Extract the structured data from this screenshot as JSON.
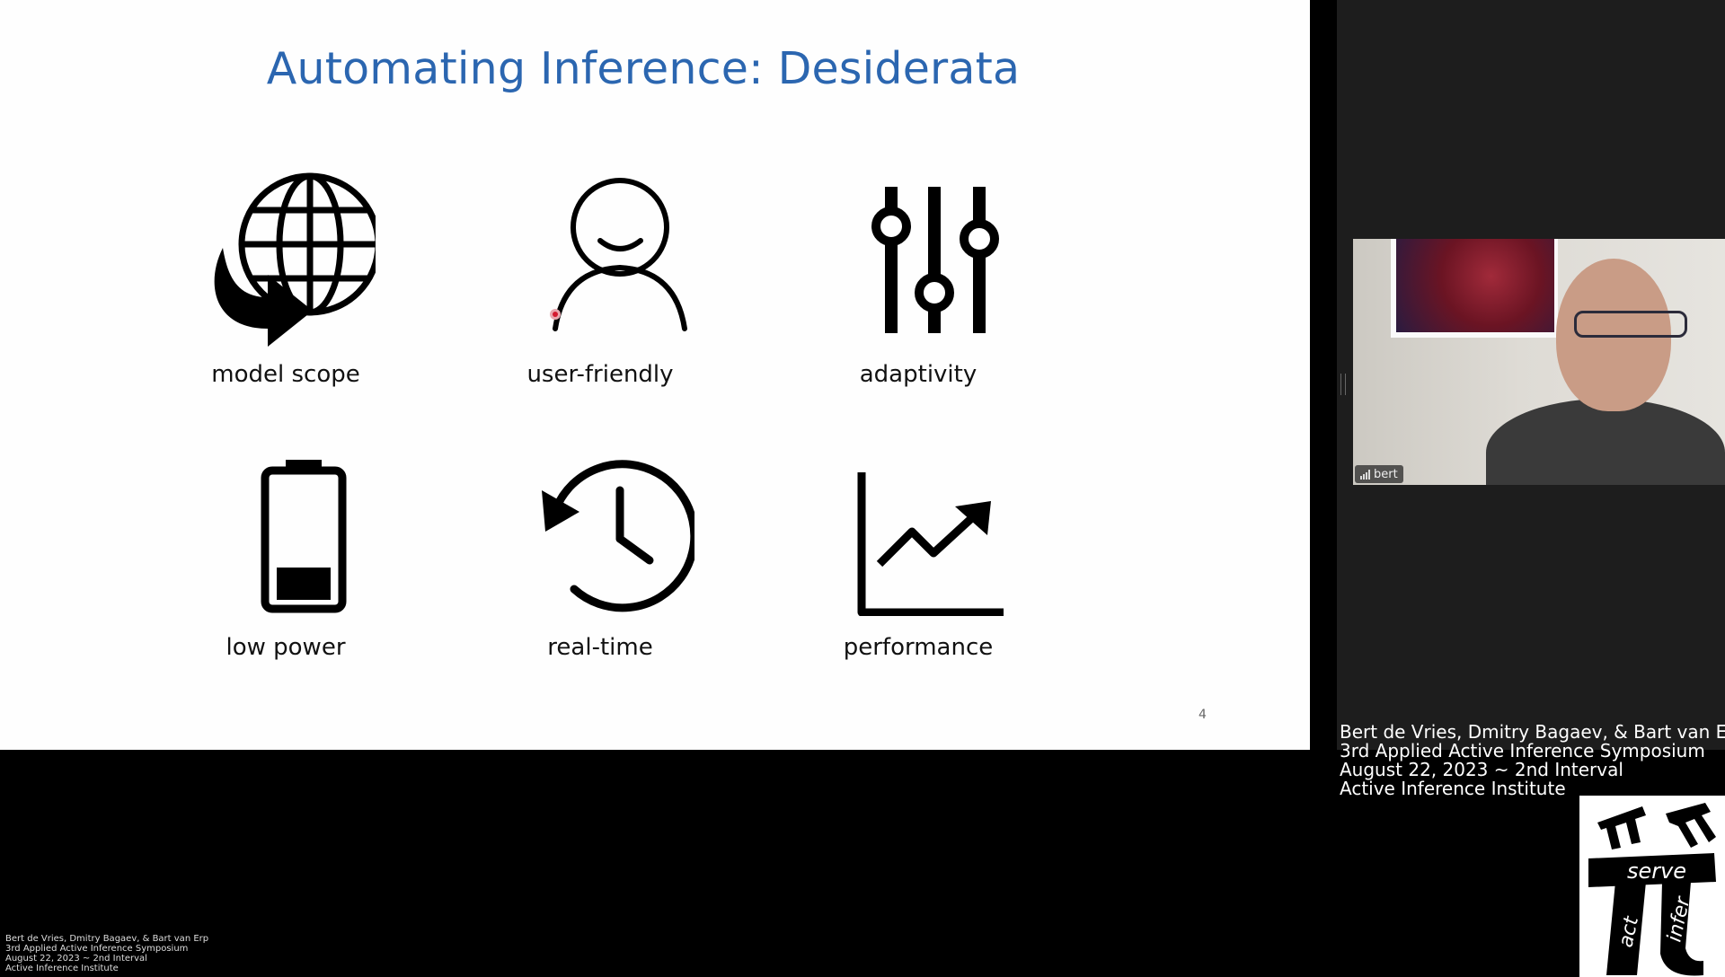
{
  "slide": {
    "title": "Automating Inference: Desiderata",
    "items": [
      {
        "label": "model scope",
        "icon": "globe-arrow-icon"
      },
      {
        "label": "user-friendly",
        "icon": "user-icon"
      },
      {
        "label": "adaptivity",
        "icon": "sliders-icon"
      },
      {
        "label": "low power",
        "icon": "low-battery-icon"
      },
      {
        "label": "real-time",
        "icon": "history-clock-icon"
      },
      {
        "label": "performance",
        "icon": "line-chart-up-icon"
      }
    ],
    "page_number": "4"
  },
  "video": {
    "participant_name": "bert"
  },
  "credits": {
    "line1": "Bert de Vries, Dmitry Bagaev, & Bart van Erp",
    "line2": "3rd Applied Active Inference Symposium",
    "line3": "August 22, 2023 ~ 2nd Interval",
    "line4": "Active Inference Institute"
  },
  "logo": {
    "word_top": "serve",
    "word_left": "act",
    "word_right": "infer"
  },
  "colors": {
    "title": "#2b66b0",
    "background": "#000000",
    "slide_background": "#fefefe",
    "cursor": "#d4192f"
  }
}
